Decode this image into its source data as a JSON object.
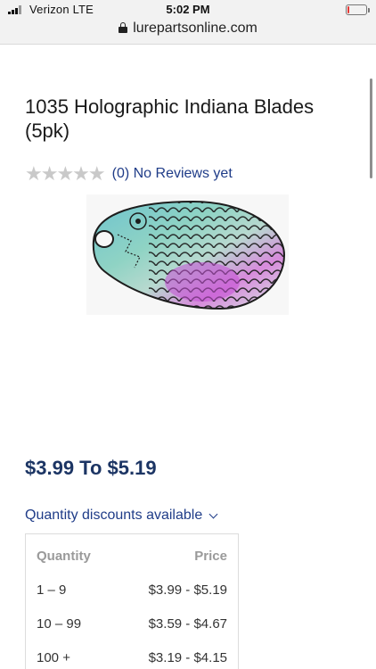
{
  "status_bar": {
    "carrier": "Verizon  LTE",
    "time": "5:02 PM",
    "battery_level": 0.1,
    "battery_color": "#e53935"
  },
  "browser": {
    "url": "lurepartsonline.com",
    "lock_icon": "lock-icon"
  },
  "product": {
    "title": "1035 Holographic Indiana Blades (5pk)",
    "rating_stars": "★★★★★",
    "rating_count_text": "(0) No Reviews yet",
    "price_range": "$3.99 To $5.19"
  },
  "discounts": {
    "toggle_label": "Quantity discounts available",
    "headers": {
      "quantity": "Quantity",
      "price": "Price"
    },
    "rows": [
      {
        "quantity": "1 – 9",
        "price": "$3.99 - $5.19"
      },
      {
        "quantity": "10 – 99",
        "price": "$3.59 - $4.67"
      },
      {
        "quantity": "100 +",
        "price": "$3.19 - $4.15"
      }
    ]
  },
  "colors": {
    "accent_blue": "#1f3c88",
    "price_navy": "#1c3564"
  }
}
